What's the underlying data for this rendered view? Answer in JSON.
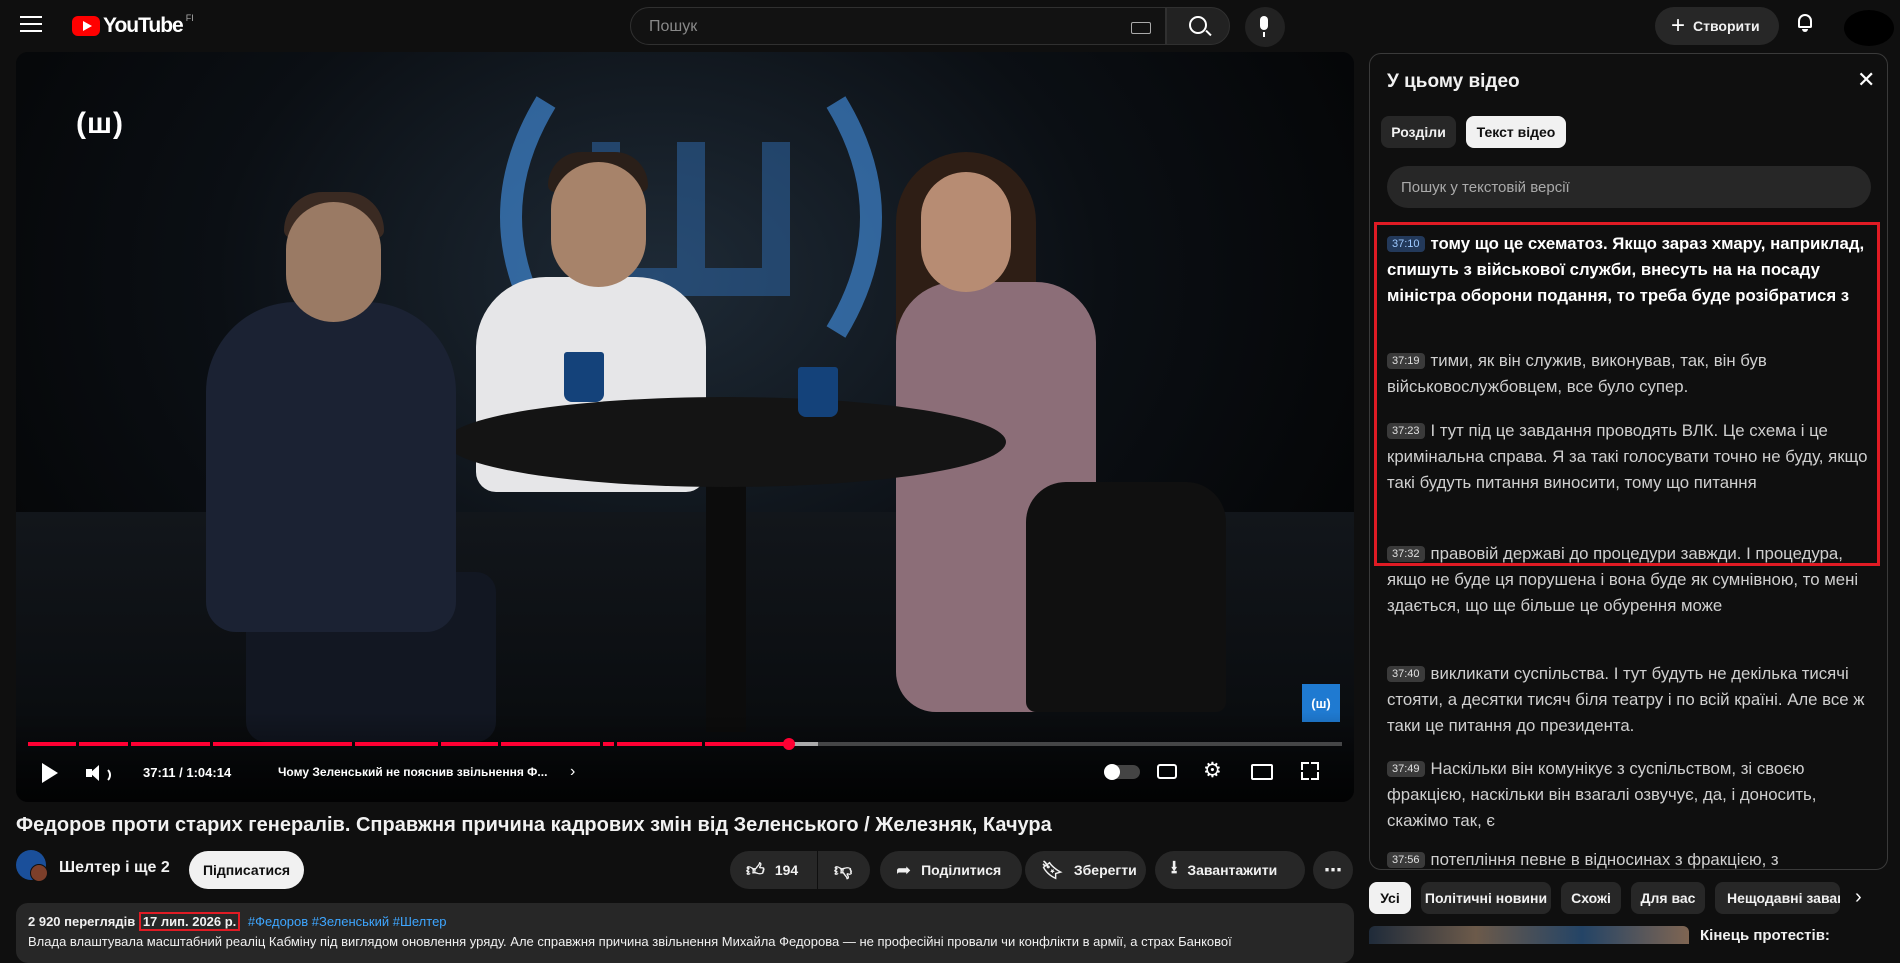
{
  "header": {
    "logo_text": "YouTube",
    "region": "FI",
    "search_placeholder": "Пошук",
    "create_label": "Створити"
  },
  "player": {
    "watermark": "(ш)",
    "corner_badge": "(ш)",
    "current_time": "37:11",
    "duration": "1:04:14",
    "time_display": "37:11 / 1:04:14",
    "progress_fraction": 0.579,
    "chapter_title": "Чому Зеленський не пояснив звільнення Ф...",
    "chapter_chevron": "›"
  },
  "video": {
    "title": "Федоров проти старих генералів. Справжня причина кадрових змін від Зеленського / Железняк, Качура",
    "channel_name": "Шелтер і ще 2",
    "subscribe_label": "Підписатися",
    "like_count": "194",
    "share_label": "Поділитися",
    "save_label": "Зберегти",
    "download_label": "Завантажити",
    "more_label": "⋯"
  },
  "description": {
    "views": "2 920 переглядів",
    "date": "17 лип. 2026 р.",
    "hashtags": "#Федоров #Зеленський #Шелтер",
    "text": "Влада влаштувала масштабний реаліц Кабміну під виглядом оновлення уряду. Але справжня причина звільнення Михайла Федорова — не професійні провали чи конфлікти в армії, а страх Банкової"
  },
  "transcript_panel": {
    "title": "У цьому відео",
    "close_icon": "✕",
    "tabs": [
      "Розділи",
      "Текст відео"
    ],
    "active_tab": "Текст відео",
    "search_placeholder": "Пошук у текстовій версії",
    "segments": [
      {
        "time": "37:10",
        "text": "тому що це схематоз. Якщо зараз хмару, наприклад, спишуть з військової служби, внесуть на на посаду міністра оборони подання, то треба буде розібратися з",
        "active": true
      },
      {
        "time": "37:19",
        "text": "тими, як він служив, виконував, так, він був військовослужбовцем, все було супер."
      },
      {
        "time": "37:23",
        "text": "І тут під це завдання проводять ВЛК. Це схема і це кримінальна справа. Я за такі голосувати точно не буду, якщо такі будуть питання виносити, тому що питання"
      },
      {
        "time": "37:32",
        "text": "правовій державі до процедури завжди. І процедура, якщо не буде ця порушена і вона буде як сумнівною, то мені здається, що ще більше це обурення може"
      },
      {
        "time": "37:40",
        "text": "викликати суспільства. І тут будуть не декілька тисячі стояти, а десятки тисяч біля театру і по всій країні. Але все ж таки це питання до президента."
      },
      {
        "time": "37:49",
        "text": "Наскільки він комунікує з суспільством, зі своєю фракцією, наскільки він взагалі озвучує, да, і доносить, скажімо так, є"
      },
      {
        "time": "37:56",
        "text": "потепління певне в відносинах з фракцією, з"
      }
    ]
  },
  "chips": {
    "items": [
      "Усі",
      "Політичні новини",
      "Схожі",
      "Для вас",
      "Нещодавні заван"
    ],
    "selected": "Усі",
    "next_icon": "›"
  },
  "recommendation": {
    "title": "Кінець протестів:"
  },
  "colors": {
    "accent": "#ff0033",
    "highlight_border": "#e01b24",
    "link": "#3ea6ff",
    "background": "#0f0f0f"
  }
}
